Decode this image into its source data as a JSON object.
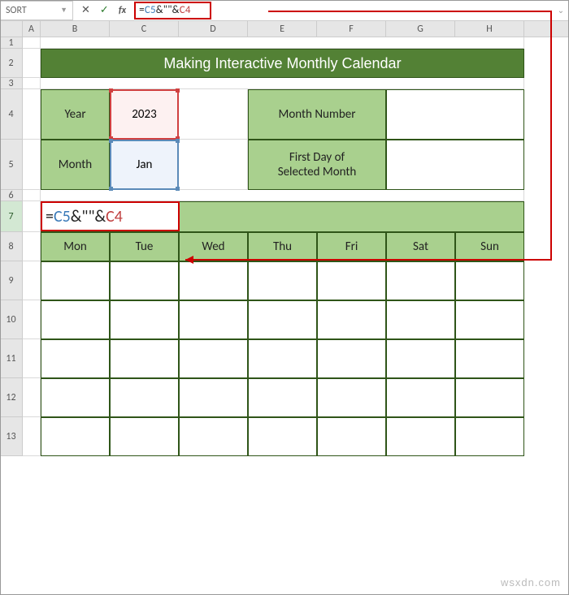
{
  "formula_bar": {
    "name_box": "SORT",
    "cancel": "✕",
    "enter": "✓",
    "fx": "fx",
    "formula_eq": "=",
    "formula_c5": "C5",
    "formula_amp1": "&\"",
    "formula_space": " ",
    "formula_amp2": "\"&",
    "formula_c4": "C4"
  },
  "columns": [
    "A",
    "B",
    "C",
    "D",
    "E",
    "F",
    "G",
    "H"
  ],
  "rows": [
    "1",
    "2",
    "3",
    "4",
    "5",
    "6",
    "7",
    "8",
    "9",
    "10",
    "11",
    "12",
    "13"
  ],
  "title": "Making Interactive Monthly Calendar",
  "year_label": "Year",
  "year_value": "2023",
  "month_label": "Month",
  "month_value": "Jan",
  "month_number_label": "Month Number",
  "first_day_label_l1": "First Day of",
  "first_day_label_l2": "Selected Month",
  "days": [
    "Mon",
    "Tue",
    "Wed",
    "Thu",
    "Fri",
    "Sat",
    "Sun"
  ],
  "watermark": "wsxdn.com"
}
